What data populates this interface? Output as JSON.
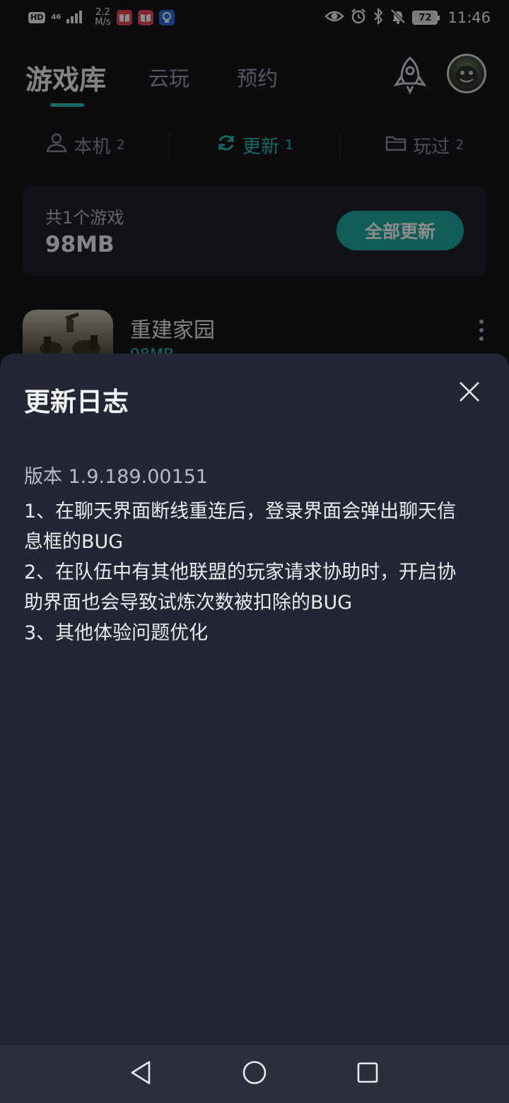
{
  "status_bar": {
    "hd": "HD",
    "net_gen": "46",
    "speed_value": "2.2",
    "speed_unit": "M/s",
    "battery": "72",
    "time": "11:46"
  },
  "header": {
    "tabs": [
      {
        "label": "游戏库"
      },
      {
        "label": "云玩"
      },
      {
        "label": "预约"
      }
    ]
  },
  "subtabs": [
    {
      "label": "本机",
      "count": "2"
    },
    {
      "label": "更新",
      "count": "1"
    },
    {
      "label": "玩过",
      "count": "2"
    }
  ],
  "summary": {
    "count_text": "共1个游戏",
    "size_text": "98MB",
    "update_all_label": "全部更新"
  },
  "game": {
    "name": "重建家园",
    "size": "98MB"
  },
  "sheet": {
    "title": "更新日志",
    "version": "版本 1.9.189.00151",
    "notes": [
      "1、在聊天界面断线重连后，登录界面会弹出聊天信",
      "息框的BUG",
      "2、在队伍中有其他联盟的玩家请求协助时，开启协",
      "助界面也会导致试炼次数被扣除的BUG",
      "3、其他体验问题优化"
    ]
  },
  "colors": {
    "accent": "#25c2b6",
    "sheet_bg": "#232633",
    "page_bg": "#16171c"
  },
  "icons": [
    "hd-icon",
    "signal-icon",
    "book-app-icon",
    "lightbulb-app-icon",
    "eye-icon",
    "alarm-icon",
    "bluetooth-icon",
    "mute-icon",
    "battery-icon",
    "rocket-icon",
    "user-icon",
    "refresh-icon",
    "folder-icon",
    "more-icon",
    "close-icon",
    "back-icon",
    "home-icon",
    "recents-icon"
  ]
}
